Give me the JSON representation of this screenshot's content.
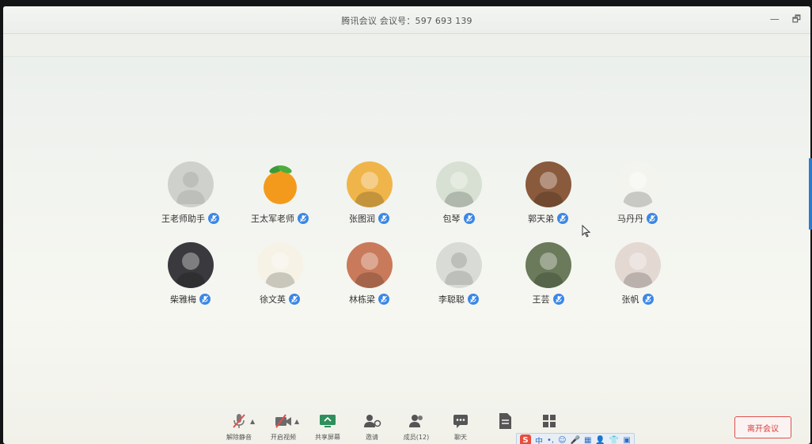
{
  "window": {
    "title": "腾讯会议 会议号：597 693 139",
    "controls": {
      "minimize": "—",
      "restore": "🗗"
    }
  },
  "participants": [
    {
      "name": "王老师助手",
      "avatar": "default-avatar",
      "avatar_color": "#cfd1cd"
    },
    {
      "name": "王太军老师",
      "avatar": "orange-avatar",
      "avatar_color": "#f39a1c"
    },
    {
      "name": "张图润",
      "avatar": "cartoon-avatar",
      "avatar_color": "#f0b54a"
    },
    {
      "name": "包琴",
      "avatar": "photo-avatar",
      "avatar_color": "#d7e0d2"
    },
    {
      "name": "郭天弟",
      "avatar": "photo-avatar",
      "avatar_color": "#8a5a3c"
    },
    {
      "name": "马丹丹",
      "avatar": "figure-avatar",
      "avatar_color": "#f4f4ef"
    },
    {
      "name": "柴雅梅",
      "avatar": "photo-avatar",
      "avatar_color": "#3a3a3e"
    },
    {
      "name": "徐文英",
      "avatar": "cartoon-girl-avatar",
      "avatar_color": "#f6f2e6"
    },
    {
      "name": "林栋梁",
      "avatar": "photo-avatar",
      "avatar_color": "#c97a5a"
    },
    {
      "name": "李聪聪",
      "avatar": "default-avatar",
      "avatar_color": "#d9dbd6"
    },
    {
      "name": "王芸",
      "avatar": "photo-avatar",
      "avatar_color": "#6a7a5a"
    },
    {
      "name": "张帆",
      "avatar": "photo-avatar",
      "avatar_color": "#e3d8d2"
    }
  ],
  "toolbar": {
    "unmute": "解除静音",
    "start_video": "开启视频",
    "share_screen": "共享屏幕",
    "invite": "邀请",
    "members": "成员(12)",
    "chat": "聊天",
    "leave": "离开会议"
  },
  "ime": {
    "logo": "S",
    "items": [
      "中",
      "•,",
      "☺",
      "🎤",
      "▦",
      "👤",
      "👕",
      "▣"
    ]
  },
  "colors": {
    "accent": "#3b87e6",
    "leave": "#d64040"
  }
}
